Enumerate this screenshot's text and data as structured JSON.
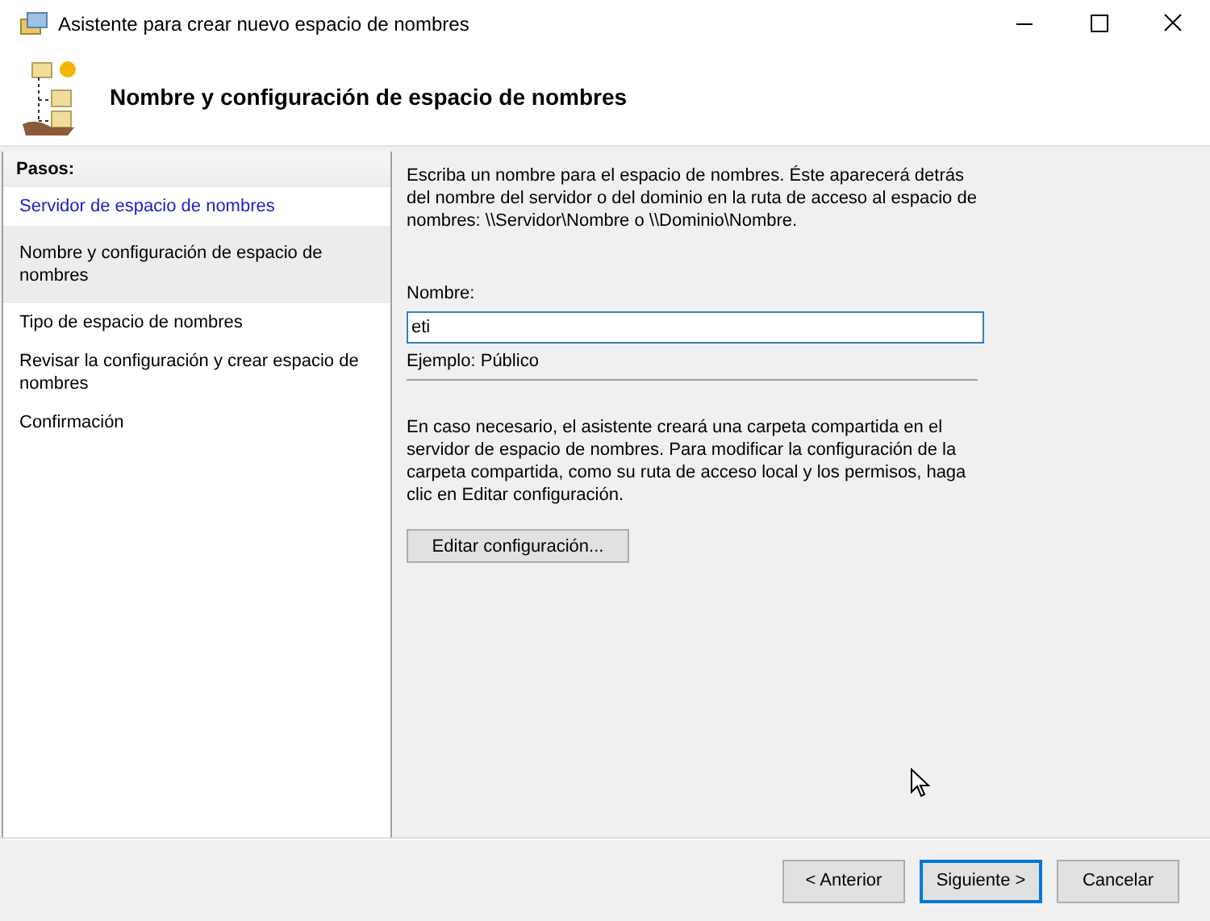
{
  "window": {
    "title": "Asistente para crear nuevo espacio de nombres"
  },
  "header": {
    "title": "Nombre y configuración de espacio de nombres"
  },
  "steps": {
    "title": "Pasos:",
    "items": [
      {
        "label": "Servidor de espacio de nombres",
        "selected": false,
        "done": true
      },
      {
        "label": "Nombre y configuración de espacio de nombres",
        "selected": true,
        "done": false
      },
      {
        "label": "Tipo de espacio de nombres",
        "selected": false,
        "done": false
      },
      {
        "label": "Revisar la configuración y crear espacio de nombres",
        "selected": false,
        "done": false
      },
      {
        "label": "Confirmación",
        "selected": false,
        "done": false
      }
    ]
  },
  "content": {
    "intro": "Escriba un nombre para el espacio de nombres. Éste aparecerá detrás del nombre del servidor o del dominio en la ruta de acceso al espacio de nombres: \\\\Servidor\\Nombre o \\\\Dominio\\Nombre.",
    "name_label": "Nombre:",
    "name_value": "eti",
    "example": "Ejemplo: Público",
    "note": "En caso necesario, el asistente creará una carpeta compartida en el servidor de espacio de nombres. Para modificar la configuración de la carpeta compartida, como su ruta de acceso local y los permisos, haga clic en Editar configuración.",
    "edit_button": "Editar configuración..."
  },
  "buttons": [
    {
      "label": "< Anterior",
      "default": false
    },
    {
      "label": "Siguiente >",
      "default": true
    },
    {
      "label": "Cancelar",
      "default": false
    }
  ]
}
